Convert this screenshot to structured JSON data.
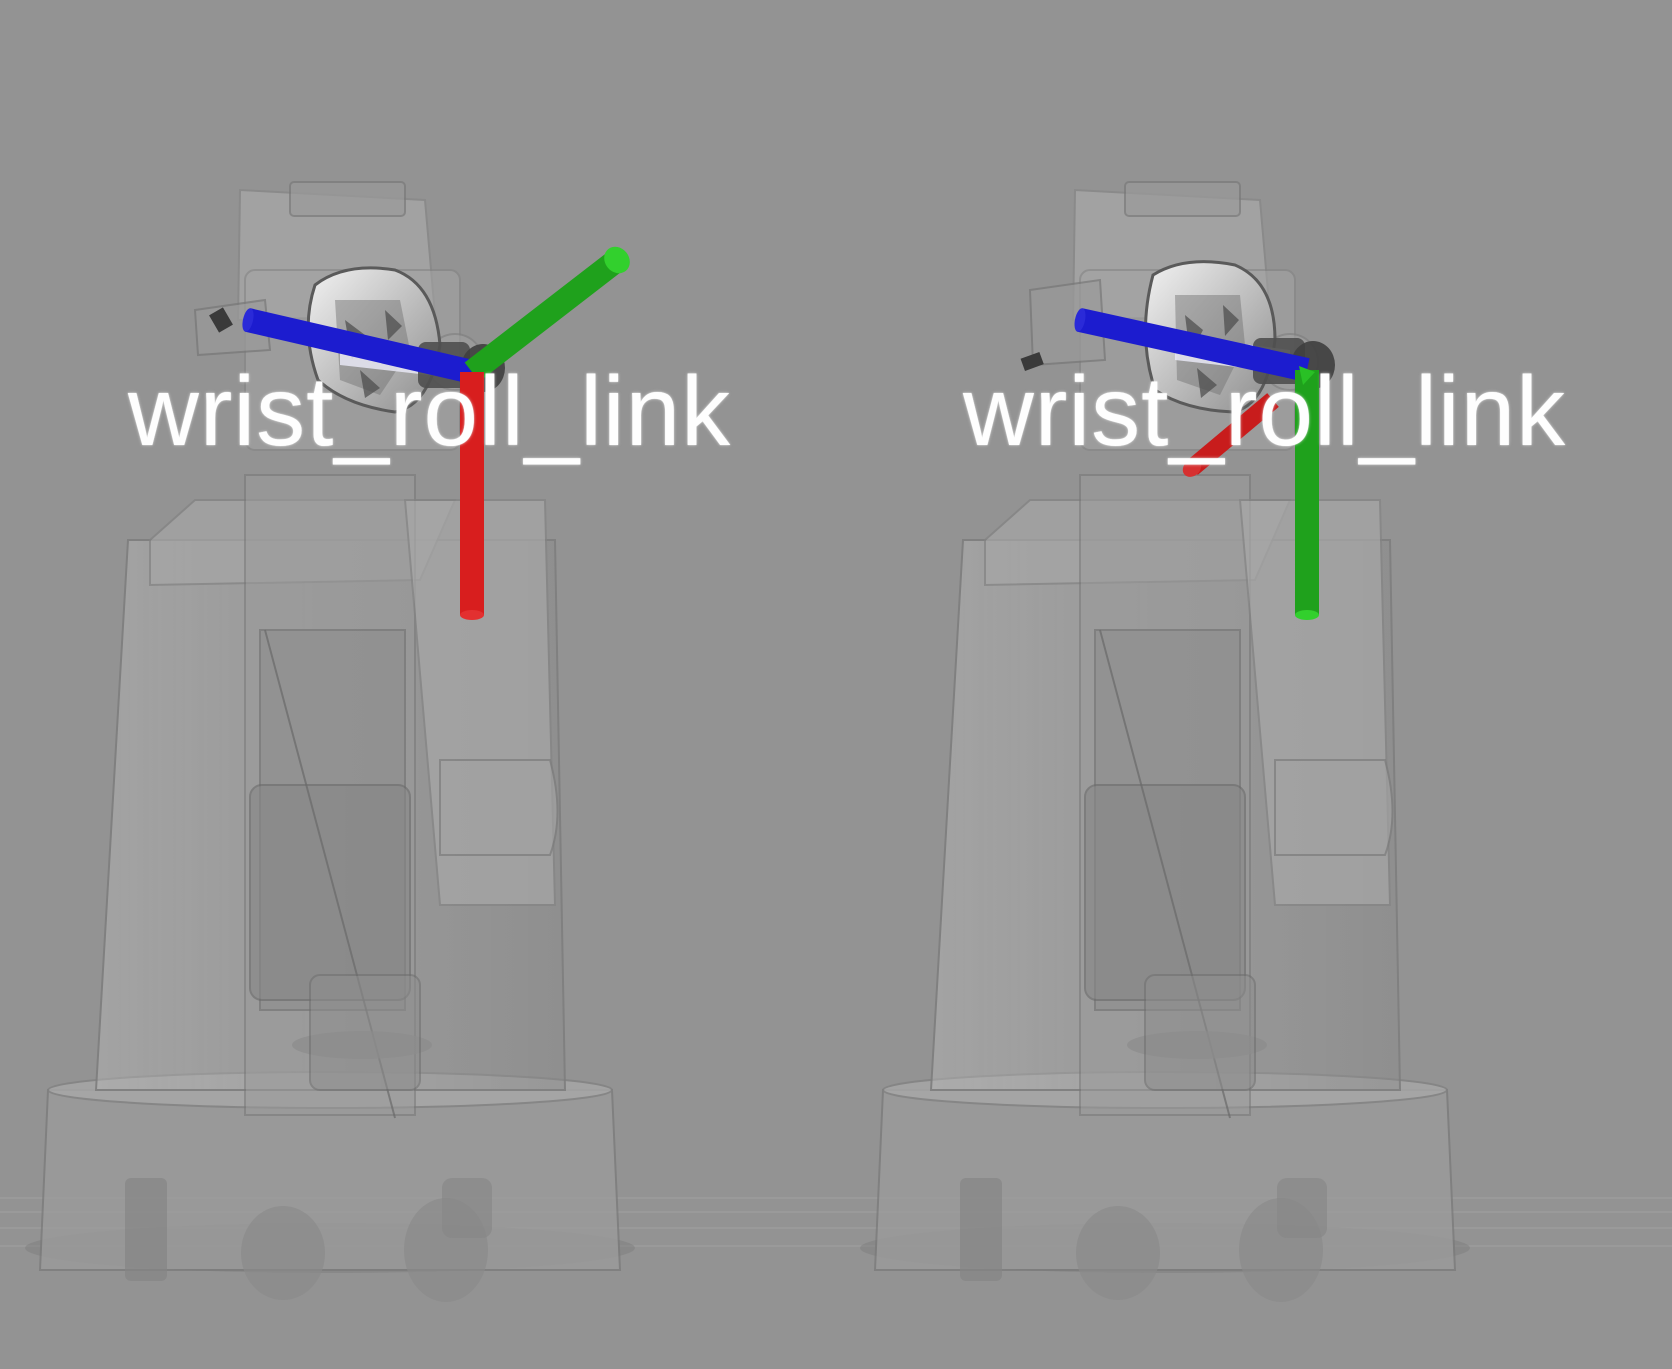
{
  "viewport": {
    "background": "#939393",
    "panels": [
      {
        "id": "left",
        "frame_label": "wrist_roll_link",
        "axes": {
          "x": "#d81e1e",
          "y": "#20b21c",
          "z": "#1c1ccf"
        }
      },
      {
        "id": "right",
        "frame_label": "wrist_roll_link",
        "axes": {
          "x": "#d81e1e",
          "y": "#20b21c",
          "z": "#1c1ccf"
        }
      }
    ]
  }
}
